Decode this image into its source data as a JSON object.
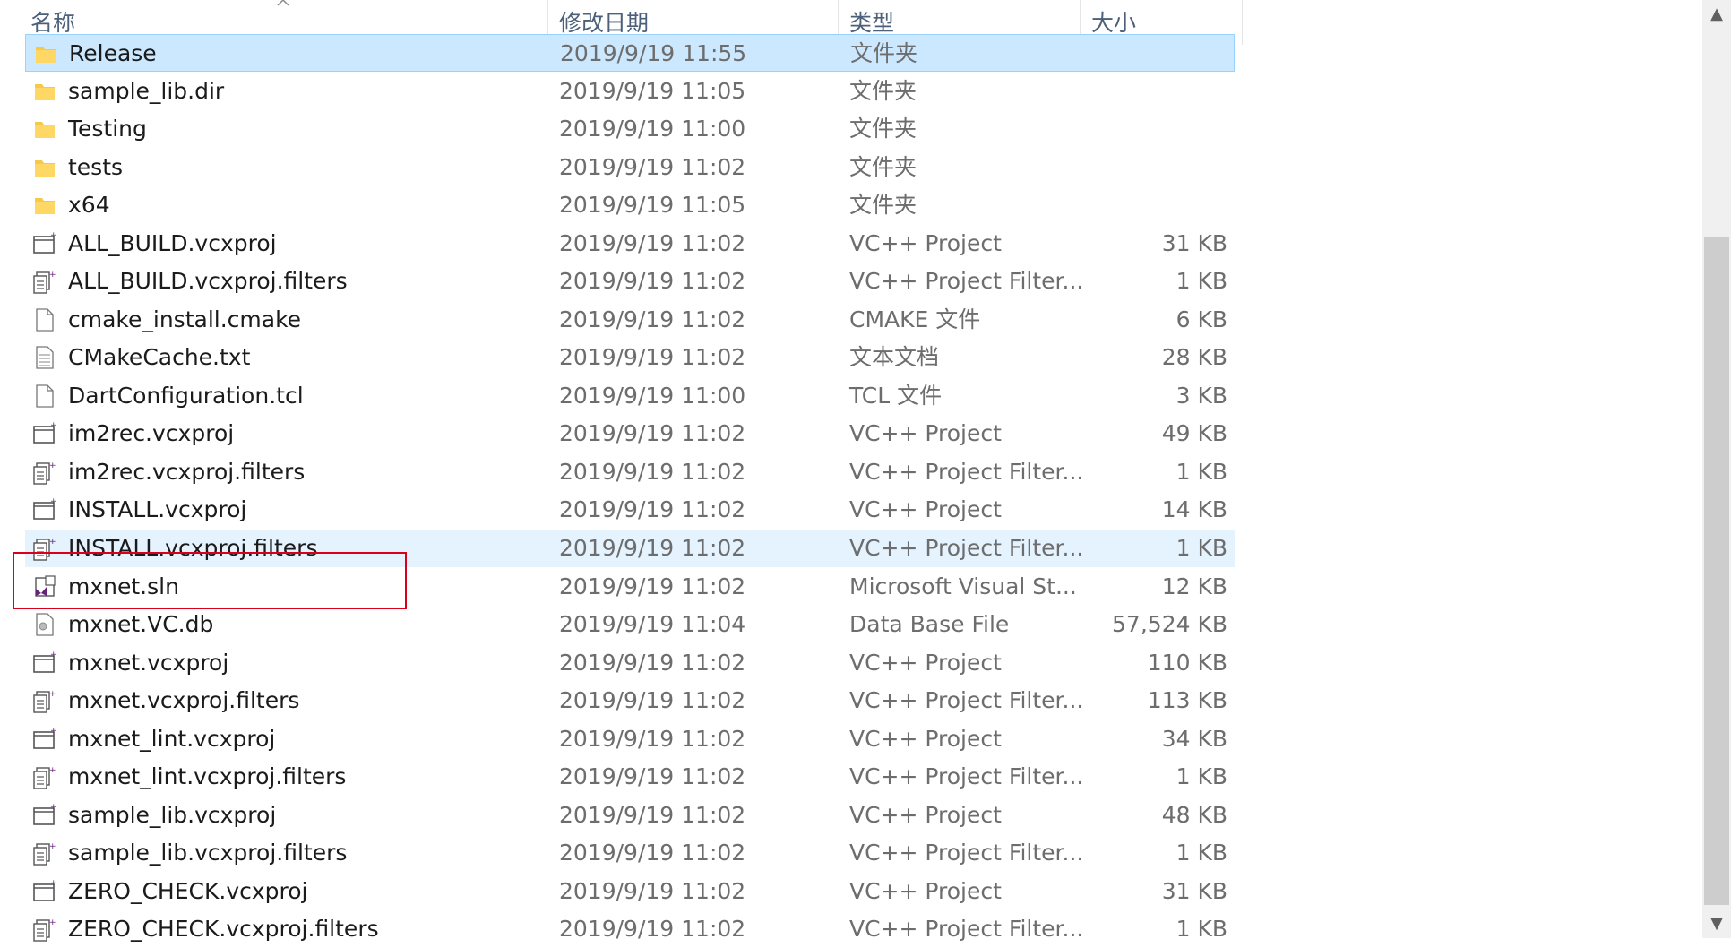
{
  "columns": {
    "name": "名称",
    "date": "修改日期",
    "type": "类型",
    "size": "大小"
  },
  "files": [
    {
      "name": "Release",
      "date": "2019/9/19 11:55",
      "type": "文件夹",
      "size": "",
      "icon": "folder-icon",
      "state": "selected"
    },
    {
      "name": "sample_lib.dir",
      "date": "2019/9/19 11:05",
      "type": "文件夹",
      "size": "",
      "icon": "folder-icon"
    },
    {
      "name": "Testing",
      "date": "2019/9/19 11:00",
      "type": "文件夹",
      "size": "",
      "icon": "folder-icon"
    },
    {
      "name": "tests",
      "date": "2019/9/19 11:02",
      "type": "文件夹",
      "size": "",
      "icon": "folder-icon"
    },
    {
      "name": "x64",
      "date": "2019/9/19 11:05",
      "type": "文件夹",
      "size": "",
      "icon": "folder-icon"
    },
    {
      "name": "ALL_BUILD.vcxproj",
      "date": "2019/9/19 11:02",
      "type": "VC++ Project",
      "size": "31 KB",
      "icon": "vcxproj-icon"
    },
    {
      "name": "ALL_BUILD.vcxproj.filters",
      "date": "2019/9/19 11:02",
      "type": "VC++ Project Filter...",
      "size": "1 KB",
      "icon": "filters-icon"
    },
    {
      "name": "cmake_install.cmake",
      "date": "2019/9/19 11:02",
      "type": "CMAKE 文件",
      "size": "6 KB",
      "icon": "blank-file-icon"
    },
    {
      "name": "CMakeCache.txt",
      "date": "2019/9/19 11:02",
      "type": "文本文档",
      "size": "28 KB",
      "icon": "text-file-icon"
    },
    {
      "name": "DartConfiguration.tcl",
      "date": "2019/9/19 11:00",
      "type": "TCL 文件",
      "size": "3 KB",
      "icon": "blank-file-icon"
    },
    {
      "name": "im2rec.vcxproj",
      "date": "2019/9/19 11:02",
      "type": "VC++ Project",
      "size": "49 KB",
      "icon": "vcxproj-icon"
    },
    {
      "name": "im2rec.vcxproj.filters",
      "date": "2019/9/19 11:02",
      "type": "VC++ Project Filter...",
      "size": "1 KB",
      "icon": "filters-icon"
    },
    {
      "name": "INSTALL.vcxproj",
      "date": "2019/9/19 11:02",
      "type": "VC++ Project",
      "size": "14 KB",
      "icon": "vcxproj-icon"
    },
    {
      "name": "INSTALL.vcxproj.filters",
      "date": "2019/9/19 11:02",
      "type": "VC++ Project Filter...",
      "size": "1 KB",
      "icon": "filters-icon",
      "state": "hover"
    },
    {
      "name": "mxnet.sln",
      "date": "2019/9/19 11:02",
      "type": "Microsoft Visual St...",
      "size": "12 KB",
      "icon": "sln-icon"
    },
    {
      "name": "mxnet.VC.db",
      "date": "2019/9/19 11:04",
      "type": "Data Base File",
      "size": "57,524 KB",
      "icon": "db-file-icon"
    },
    {
      "name": "mxnet.vcxproj",
      "date": "2019/9/19 11:02",
      "type": "VC++ Project",
      "size": "110 KB",
      "icon": "vcxproj-icon"
    },
    {
      "name": "mxnet.vcxproj.filters",
      "date": "2019/9/19 11:02",
      "type": "VC++ Project Filter...",
      "size": "113 KB",
      "icon": "filters-icon"
    },
    {
      "name": "mxnet_lint.vcxproj",
      "date": "2019/9/19 11:02",
      "type": "VC++ Project",
      "size": "34 KB",
      "icon": "vcxproj-icon"
    },
    {
      "name": "mxnet_lint.vcxproj.filters",
      "date": "2019/9/19 11:02",
      "type": "VC++ Project Filter...",
      "size": "1 KB",
      "icon": "filters-icon"
    },
    {
      "name": "sample_lib.vcxproj",
      "date": "2019/9/19 11:02",
      "type": "VC++ Project",
      "size": "48 KB",
      "icon": "vcxproj-icon"
    },
    {
      "name": "sample_lib.vcxproj.filters",
      "date": "2019/9/19 11:02",
      "type": "VC++ Project Filter...",
      "size": "1 KB",
      "icon": "filters-icon"
    },
    {
      "name": "ZERO_CHECK.vcxproj",
      "date": "2019/9/19 11:02",
      "type": "VC++ Project",
      "size": "31 KB",
      "icon": "vcxproj-icon"
    },
    {
      "name": "ZERO_CHECK.vcxproj.filters",
      "date": "2019/9/19 11:02",
      "type": "VC++ Project Filter...",
      "size": "1 KB",
      "icon": "filters-icon"
    }
  ],
  "colors": {
    "selected_bg": "#cce8ff",
    "hover_bg": "#e5f3ff",
    "highlight_border": "#d9001b",
    "folder": "#f7c948",
    "sln_purple": "#68217a"
  }
}
